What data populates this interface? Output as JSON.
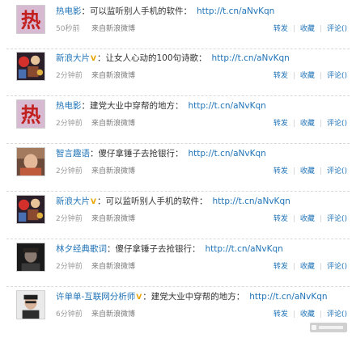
{
  "colors": {
    "link": "#1f73b7",
    "meta": "#999999",
    "verified": "#e8a400"
  },
  "labels": {
    "separator": "：",
    "verified_mark": "V",
    "repost": "转发",
    "favorite": "收藏",
    "comment": "评论()"
  },
  "posts": [
    {
      "author": "热电影",
      "verified": false,
      "content": "可以监听别人手机的软件：",
      "link": "http://t.cn/aNvKqn",
      "time": "50秒前",
      "source": "来自新浪微博",
      "avatar_icon": "hot-character-avatar"
    },
    {
      "author": "新浪大片",
      "verified": true,
      "content": "让女人心动的100句诗歌：",
      "link": "http://t.cn/aNvKqn",
      "time": "2分钟前",
      "source": "来自新浪微博",
      "avatar_icon": "movie-poster-avatar"
    },
    {
      "author": "热电影",
      "verified": false,
      "content": "建党大业中穿帮的地方：",
      "link": "http://t.cn/aNvKqn",
      "time": "2分钟前",
      "source": "来自新浪微博",
      "avatar_icon": "hot-character-avatar"
    },
    {
      "author": "智言趣语",
      "verified": false,
      "content": "傻仔拿锤子去抢银行：",
      "link": "http://t.cn/aNvKqn",
      "time": "2分钟前",
      "source": "来自新浪微博",
      "avatar_icon": "portrait-avatar"
    },
    {
      "author": "新浪大片",
      "verified": true,
      "content": "可以监听别人手机的软件：",
      "link": "http://t.cn/aNvKqn",
      "time": "2分钟前",
      "source": "来自新浪微博",
      "avatar_icon": "movie-poster-avatar"
    },
    {
      "author": "林夕经典歌词",
      "verified": false,
      "content": "傻仔拿锤子去抢银行：",
      "link": "http://t.cn/aNvKqn",
      "time": "2分钟前",
      "source": "来自新浪微博",
      "avatar_icon": "dark-portrait-avatar"
    },
    {
      "author": "许单单-互联网分析师",
      "verified": true,
      "content": "建党大业中穿帮的地方：",
      "link": "http://t.cn/aNvKqn",
      "time": "6分钟前",
      "source": "来自新浪微博",
      "avatar_icon": "man-portrait-avatar"
    }
  ]
}
